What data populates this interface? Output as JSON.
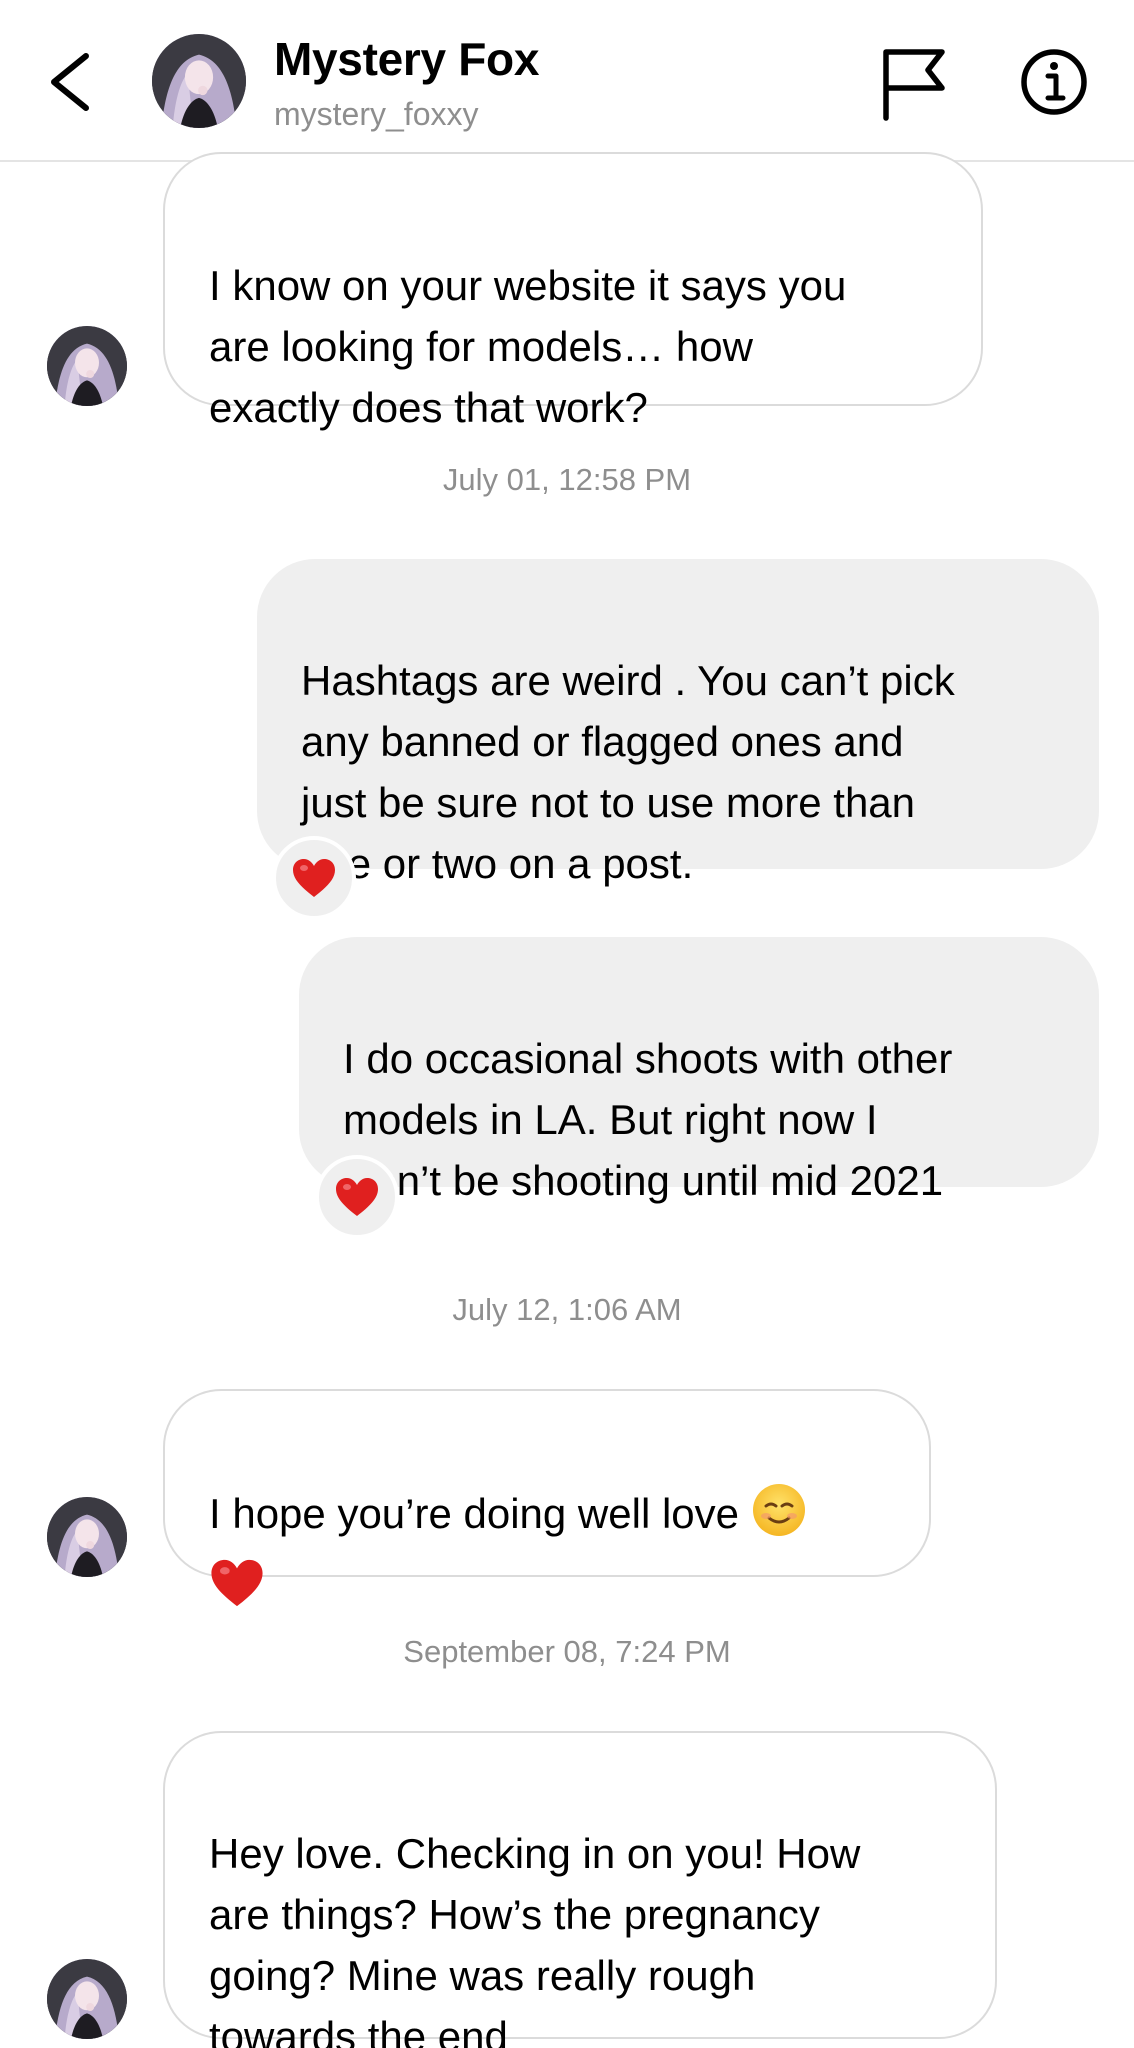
{
  "header": {
    "name": "Mystery Fox",
    "username": "mystery_foxxy"
  },
  "messages": [
    {
      "direction": "incoming",
      "text": "I know on your website it says you\nare looking for models… how\nexactly does that work?"
    },
    {
      "direction": "outgoing",
      "text": "Hashtags are weird . You can’t pick\nany banned or flagged ones and\njust be sure not to use more than\none or two on a post.",
      "reaction": "red-heart"
    },
    {
      "direction": "outgoing",
      "text": "I do occasional shoots with other\nmodels in LA.  But right now I\nwon’t be shooting until mid 2021",
      "reaction": "red-heart"
    },
    {
      "direction": "incoming",
      "text": "I hope you’re doing well love",
      "emojis": [
        "smiling-face",
        "red-heart"
      ]
    },
    {
      "direction": "incoming",
      "text": "Hey love. Checking in on you! How\nare things? How’s the pregnancy\ngoing? Mine was really rough\ntowards the end"
    }
  ],
  "timestamps": [
    "July 01, 12:58 PM",
    "July 12, 1:06 AM",
    "September 08, 7:24 PM"
  ],
  "colors": {
    "incoming_border": "#dbdbdb",
    "outgoing_fill": "#efefef",
    "muted_text": "#8e8e8e",
    "heart_red": "#e0201f"
  }
}
